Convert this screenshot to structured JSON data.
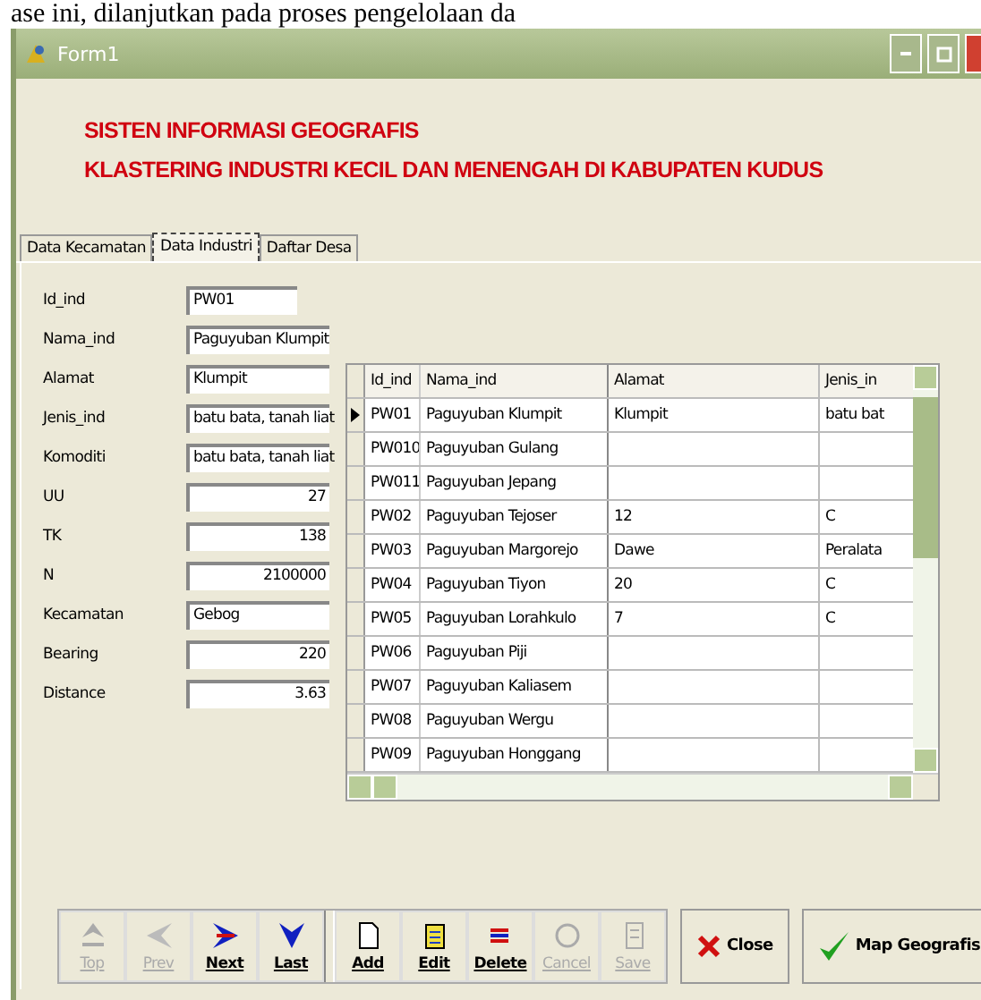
{
  "document_text": "ase ini, dilanjutkan pada proses pengelolaan da",
  "window": {
    "title": "Form1"
  },
  "heading": [
    "SISTEN INFORMASI GEOGRAFIS",
    "KLASTERING INDUSTRI KECIL DAN MENENGAH DI KABUPATEN KUDUS"
  ],
  "tabs": [
    {
      "label": "Data Kecamatan",
      "selected": false
    },
    {
      "label": "Data Industri",
      "selected": true
    },
    {
      "label": "Daftar Desa",
      "selected": false
    }
  ],
  "fields": [
    {
      "label": "Id_ind",
      "value": "PW01",
      "kind": "key"
    },
    {
      "label": "Nama_ind",
      "value": "Paguyuban Klumpit",
      "kind": "text"
    },
    {
      "label": "Alamat",
      "value": "Klumpit",
      "kind": "text"
    },
    {
      "label": "Jenis_ind",
      "value": "batu bata, tanah liat",
      "kind": "text"
    },
    {
      "label": "Komoditi",
      "value": "batu bata, tanah liat",
      "kind": "text"
    },
    {
      "label": "UU",
      "value": "27",
      "kind": "number"
    },
    {
      "label": "TK",
      "value": "138",
      "kind": "number"
    },
    {
      "label": "N",
      "value": "2100000",
      "kind": "number"
    },
    {
      "label": "Kecamatan",
      "value": "Gebog",
      "kind": "text"
    },
    {
      "label": "Bearing",
      "value": "220",
      "kind": "number"
    },
    {
      "label": "Distance",
      "value": "3.63",
      "kind": "number"
    }
  ],
  "table": {
    "columns": [
      "Id_ind",
      "Nama_ind",
      "Alamat",
      "Jenis_in"
    ],
    "rows": [
      {
        "selected": true,
        "cells": [
          "PW01",
          "Paguyuban Klumpit",
          "Klumpit",
          "batu bat"
        ]
      },
      {
        "selected": false,
        "cells": [
          "PW010",
          "Paguyuban Gulang",
          "",
          ""
        ]
      },
      {
        "selected": false,
        "cells": [
          "PW011",
          "Paguyuban Jepang",
          "",
          ""
        ]
      },
      {
        "selected": false,
        "cells": [
          "PW02",
          "Paguyuban Tejoser",
          "12",
          "C"
        ]
      },
      {
        "selected": false,
        "cells": [
          "PW03",
          "Paguyuban Margorejo",
          "Dawe",
          "Peralata"
        ]
      },
      {
        "selected": false,
        "cells": [
          "PW04",
          "Paguyuban Tiyon",
          "20",
          "C"
        ]
      },
      {
        "selected": false,
        "cells": [
          "PW05",
          "Paguyuban Lorahkulo",
          "7",
          "C"
        ]
      },
      {
        "selected": false,
        "cells": [
          "PW06",
          "Paguyuban Piji",
          "",
          ""
        ]
      },
      {
        "selected": false,
        "cells": [
          "PW07",
          "Paguyuban Kaliasem",
          "",
          ""
        ]
      },
      {
        "selected": false,
        "cells": [
          "PW08",
          "Paguyuban Wergu",
          "",
          ""
        ]
      },
      {
        "selected": false,
        "cells": [
          "PW09",
          "Paguyuban Honggang",
          "",
          ""
        ]
      }
    ]
  },
  "navigator": [
    {
      "label": "Top",
      "kind": "top",
      "disabled": true
    },
    {
      "label": "Prev",
      "kind": "prev",
      "disabled": true
    },
    {
      "label": "Next",
      "kind": "next",
      "disabled": false
    },
    {
      "label": "Last",
      "kind": "last",
      "disabled": false
    },
    {
      "label": "Add",
      "kind": "add",
      "disabled": false
    },
    {
      "label": "Edit",
      "kind": "edit",
      "disabled": false
    },
    {
      "label": "Delete",
      "kind": "delete",
      "disabled": false
    },
    {
      "label": "Cancel",
      "kind": "cancel",
      "disabled": true
    },
    {
      "label": "Save",
      "kind": "save",
      "disabled": true
    }
  ],
  "buttons": [
    {
      "label": "Close",
      "kind": "close"
    },
    {
      "label": "Map Geografis",
      "kind": "map"
    }
  ]
}
